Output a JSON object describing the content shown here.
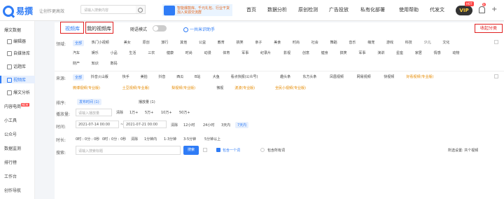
{
  "header": {
    "brand": "易撰",
    "slogan": "让创作更高效",
    "search_placeholder": "请输入搜索内容",
    "ad": {
      "line1": "智能爆款库、千元礼包、行业干货",
      "line2": "加入资源交流群"
    },
    "nav": [
      "首页",
      "数据分析",
      "原创检测",
      "广告投放",
      "私有化部署",
      "使用帮助",
      "代发文"
    ],
    "vip_label": "VIP",
    "hot_label": "HOT",
    "bell_count": "8",
    "plus_label": "+"
  },
  "sidebar": {
    "sections": [
      {
        "label": "爆文数据",
        "caret": "⌃"
      },
      {
        "label": "编辑器"
      },
      {
        "label": "自媒体库"
      },
      {
        "label": "话题库"
      },
      {
        "label": "视频库"
      },
      {
        "label": "爆文分析"
      },
      {
        "label": "内容电商",
        "badge": "NEW"
      },
      {
        "label": "小工具"
      },
      {
        "label": "公众号"
      },
      {
        "label": "数据监测"
      },
      {
        "label": "排行榜"
      },
      {
        "label": "工作台"
      },
      {
        "label": "创作导航"
      }
    ]
  },
  "tabs": {
    "video_lib": "视频库",
    "my_video_lib": "我的视频库",
    "random_mode": "随语模式",
    "helper": "一共米识助手",
    "right_tag": "收起分类"
  },
  "filters": {
    "field_label": "领域:",
    "field_row1": [
      "全部",
      "热门小视频",
      "美女",
      "原创",
      "旅行",
      "其他",
      "公益",
      "教育",
      "搞笑",
      "亲子",
      "美食",
      "时尚",
      "社会",
      "舞蹈",
      "音乐",
      "萌宠",
      "游戏",
      "科技",
      "少儿",
      "文化"
    ],
    "field_row2": [
      "汽车",
      "娱乐",
      "小品",
      "生活",
      "三农",
      "健康",
      "时尚",
      "动漫",
      "体育",
      "军事",
      "纪录片",
      "影视",
      "创意",
      "健身",
      "搞笑",
      "军事",
      "演讲",
      "星座",
      "家居",
      "情感",
      "动物"
    ],
    "field_row3": [
      "財产",
      "知识",
      "数码"
    ],
    "source_label": "来源:",
    "source_row1": [
      "全部",
      "抖音火山版",
      "快手",
      "美拍",
      "抖音",
      "西瓜",
      "B站",
      "大鱼",
      "看点快报(公众号)",
      "趣头条",
      "东方头条",
      "凤凰视频",
      "网易视频",
      "快视频",
      "好看视频(专业版)"
    ],
    "source_row2": [
      "微博视频(专业版)",
      "土豆视频(专业版)",
      "梨视频(专业版)",
      "微视",
      "波波(专业版)",
      "全民小视频(专业版)"
    ],
    "sort_label": "排序:",
    "sort_options": [
      "发布时间 (1)",
      "播放量 (1)"
    ],
    "plays_label": "播放量:",
    "plays_placeholder": "请输入播放量",
    "plays_options": [
      "清除",
      "1万+",
      "5万+",
      "10万+",
      "50万+"
    ],
    "time_label": "时间:",
    "date_from": "2021-07-14 00:00",
    "date_to": "2021-07-21 00:00",
    "time_options": [
      "清除",
      "12小时",
      "24小时",
      "3天内",
      "7天内"
    ],
    "duration_label": "时长:",
    "duration_from": "0时 : 0分 : 0秒",
    "duration_to": "0时 : 0分 : 0秒",
    "duration_options": [
      "清除",
      "1分钟内",
      "1-3分钟",
      "3-5分钟",
      "5分钟以上"
    ],
    "search_label": "搜索:",
    "search_placeholder": "请输入搜索标题",
    "search_button": "搜索",
    "match_option": "包含一个词",
    "all_option": "包含所有词",
    "result_text": "所选设置: 共个视频"
  },
  "colors": {
    "accent": "#2f7cf6",
    "highlight": "#e02020",
    "pro": "#e58a00"
  }
}
